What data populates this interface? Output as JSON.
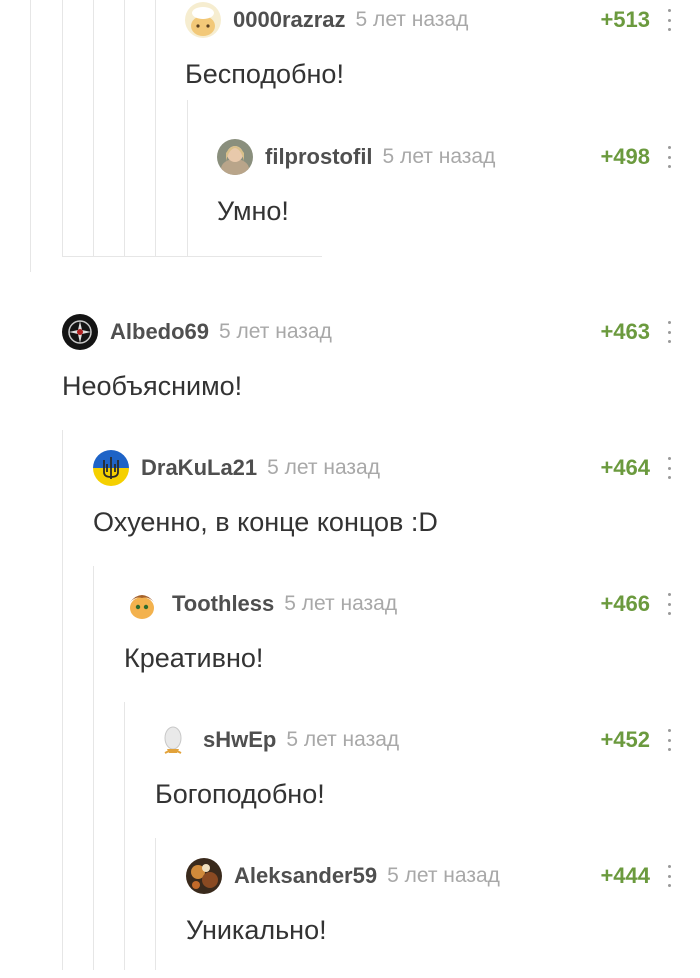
{
  "comments": [
    {
      "username": "0000razraz",
      "time": "5 лет назад",
      "rating": "+513",
      "text": "Бесподобно!",
      "avatar_icon": "cartoon-avatar-icon"
    },
    {
      "username": "filprostofil",
      "time": "5 лет назад",
      "rating": "+498",
      "text": "Умно!",
      "avatar_icon": "photo-avatar-icon"
    },
    {
      "username": "Albedo69",
      "time": "5 лет назад",
      "rating": "+463",
      "text": "Необъяснимо!",
      "avatar_icon": "dark-emblem-avatar-icon"
    },
    {
      "username": "DraKuLa21",
      "time": "5 лет назад",
      "rating": "+464",
      "text": "Охуенно, в конце концов :D",
      "avatar_icon": "ukraine-trident-avatar-icon"
    },
    {
      "username": "Toothless",
      "time": "5 лет назад",
      "rating": "+466",
      "text": "Креативно!",
      "avatar_icon": "pony-avatar-icon"
    },
    {
      "username": "sHwEp",
      "time": "5 лет назад",
      "rating": "+452",
      "text": "Богоподобно!",
      "avatar_icon": "egg-avatar-icon"
    },
    {
      "username": "Aleksander59",
      "time": "5 лет назад",
      "rating": "+444",
      "text": "Уникально!",
      "avatar_icon": "photo-avatar-icon"
    }
  ],
  "colors": {
    "rating": "#6b9a3e",
    "username": "#4f4f4f",
    "time": "#a8a8a8",
    "text": "#333333",
    "thread_line": "#e6e6e6"
  }
}
